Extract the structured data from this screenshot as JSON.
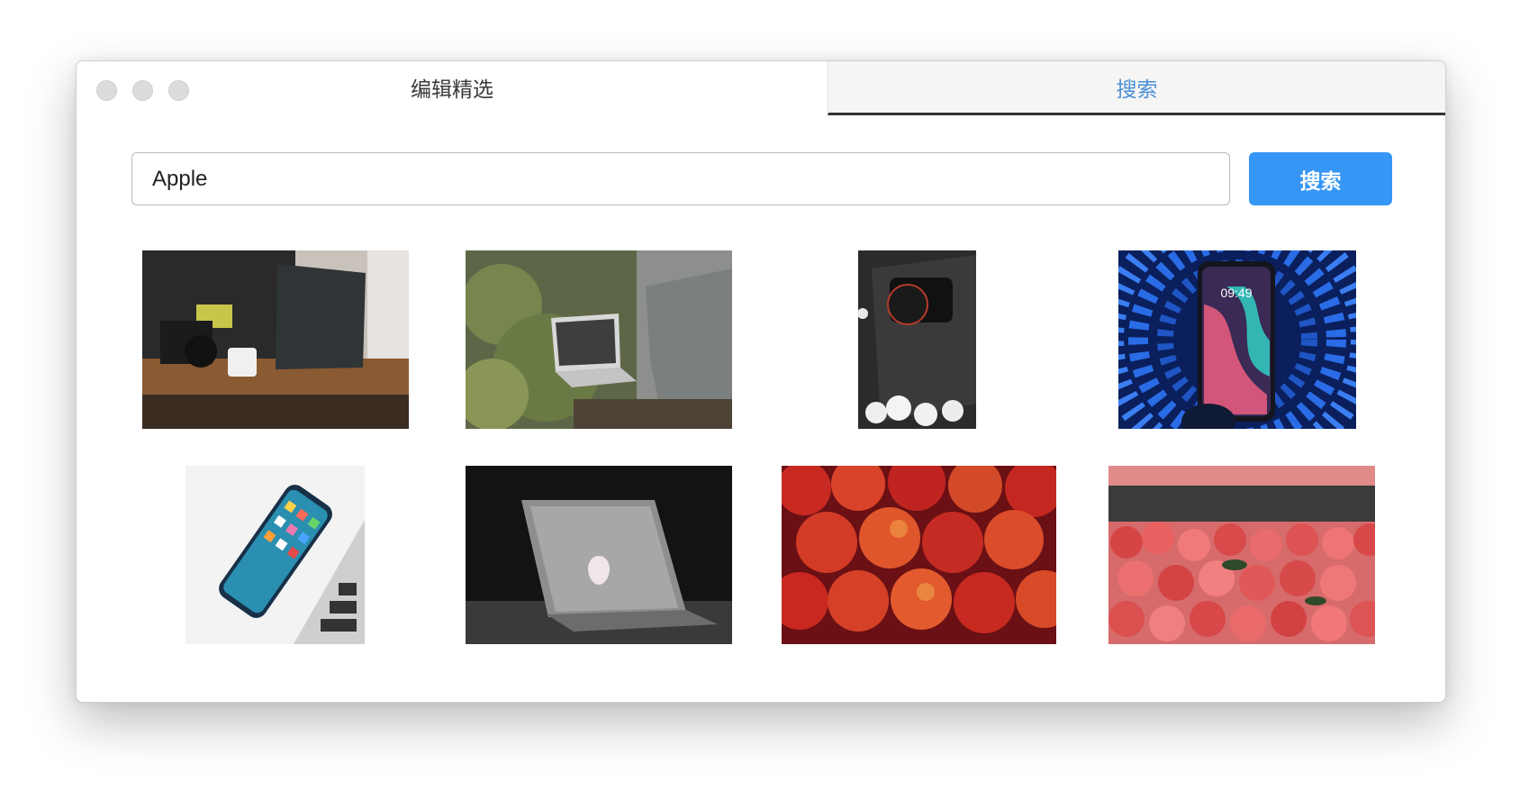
{
  "window": {
    "controls": [
      "close",
      "minimize",
      "zoom"
    ]
  },
  "tabs": {
    "editor_picks": "编辑精选",
    "search": "搜索",
    "active": "search",
    "active_color": "#4a8fd6"
  },
  "search": {
    "value": "Apple",
    "button_label": "搜索",
    "button_color": "#3596f5"
  },
  "results": [
    {
      "subject": "laptop-and-camera-on-wooden-desk"
    },
    {
      "subject": "person-using-laptop-among-plants"
    },
    {
      "subject": "camera-lens-on-black-laptop-with-cotton"
    },
    {
      "subject": "hand-holding-iphone-blue-light-tunnel",
      "screen_text": "09:49"
    },
    {
      "subject": "iphone-on-macbook-keyboard"
    },
    {
      "subject": "silver-macbook-dark-background"
    },
    {
      "subject": "red-apples-pile"
    },
    {
      "subject": "red-apples-in-crate"
    }
  ]
}
